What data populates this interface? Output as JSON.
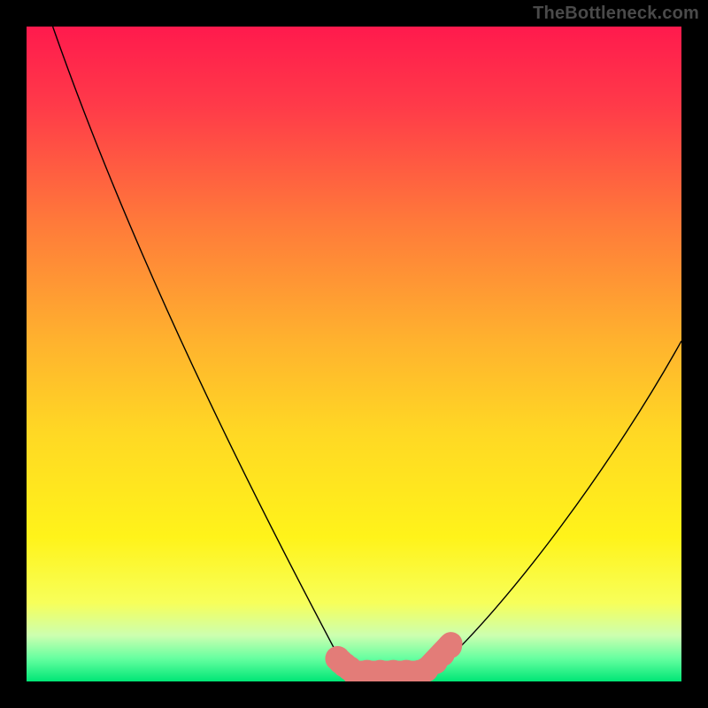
{
  "watermark": "TheBottleneck.com",
  "chart_data": {
    "type": "line",
    "title": "",
    "xlabel": "",
    "ylabel": "",
    "xlim": [
      0,
      100
    ],
    "ylim": [
      0,
      100
    ],
    "background_gradient": {
      "stops": [
        {
          "offset": 0.0,
          "color": "#ff1a4d"
        },
        {
          "offset": 0.12,
          "color": "#ff3a49"
        },
        {
          "offset": 0.3,
          "color": "#ff7a3a"
        },
        {
          "offset": 0.48,
          "color": "#ffb22e"
        },
        {
          "offset": 0.62,
          "color": "#ffd824"
        },
        {
          "offset": 0.78,
          "color": "#fff31a"
        },
        {
          "offset": 0.88,
          "color": "#f7ff5a"
        },
        {
          "offset": 0.93,
          "color": "#ccffb0"
        },
        {
          "offset": 0.965,
          "color": "#66ffa0"
        },
        {
          "offset": 1.0,
          "color": "#00e676"
        }
      ]
    },
    "series": [
      {
        "name": "left-branch",
        "x": [
          4,
          7,
          10,
          14,
          18,
          22,
          26,
          30,
          34,
          38,
          42,
          45,
          47,
          49,
          50
        ],
        "y": [
          100,
          92,
          84,
          76,
          68,
          60,
          52,
          44,
          36,
          28,
          20,
          13,
          8,
          3,
          0
        ],
        "style": "black-curve"
      },
      {
        "name": "right-branch",
        "x": [
          62,
          66,
          70,
          74,
          78,
          82,
          86,
          90,
          94,
          98,
          100
        ],
        "y": [
          0,
          6,
          12,
          18,
          24,
          30,
          35,
          40,
          45,
          49,
          52
        ],
        "style": "black-curve"
      },
      {
        "name": "flat-bottom",
        "x": [
          50,
          56,
          62
        ],
        "y": [
          0,
          0,
          0
        ],
        "style": "none"
      }
    ],
    "markers": [
      {
        "name": "left-cluster",
        "points": [
          [
            47.5,
            96.5
          ],
          [
            48.0,
            97.0
          ],
          [
            48.6,
            97.5
          ],
          [
            49.3,
            98.0
          ]
        ],
        "color": "#e37c78",
        "r": 1.9
      },
      {
        "name": "bottom-band",
        "points": [
          [
            50,
            98.6
          ],
          [
            52,
            98.6
          ],
          [
            54,
            98.6
          ],
          [
            56,
            98.6
          ],
          [
            58,
            98.6
          ],
          [
            60,
            98.6
          ]
        ],
        "color": "#e37c78",
        "r": 1.9
      },
      {
        "name": "right-cluster",
        "points": [
          [
            61.0,
            98.2
          ],
          [
            62.4,
            97.0
          ],
          [
            63.5,
            95.8
          ],
          [
            64.6,
            94.6
          ]
        ],
        "color": "#e37c78",
        "r": 1.9
      }
    ]
  }
}
